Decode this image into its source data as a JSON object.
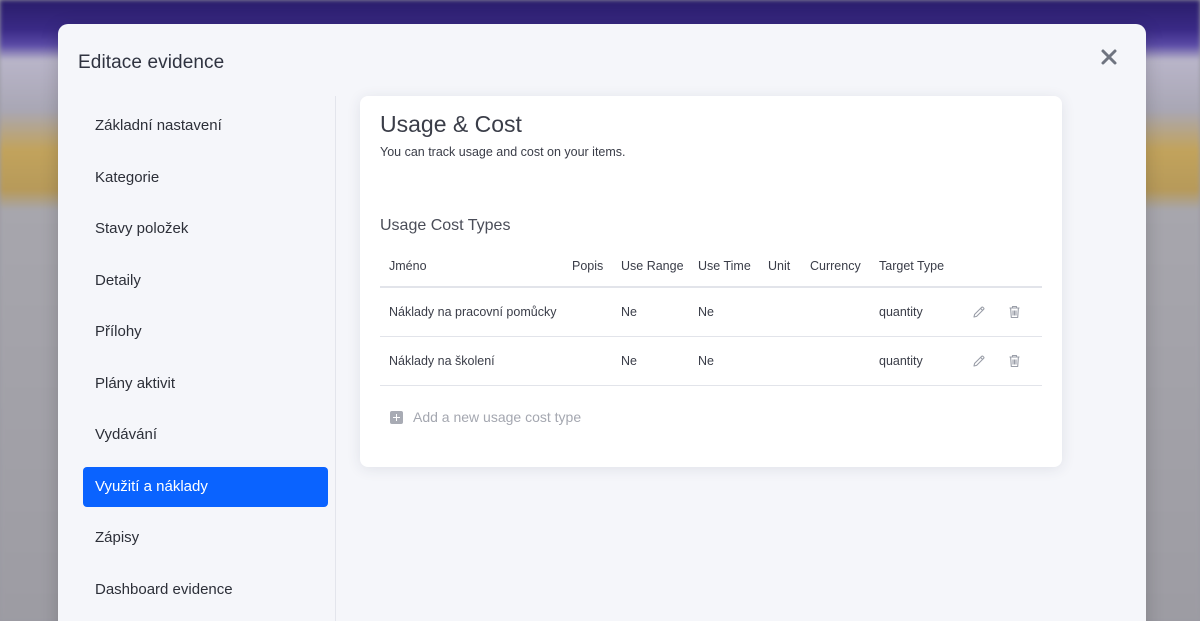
{
  "modal": {
    "title": "Editace evidence"
  },
  "sidebar": {
    "items": [
      {
        "label": "Základní nastavení",
        "active": false
      },
      {
        "label": "Kategorie",
        "active": false
      },
      {
        "label": "Stavy položek",
        "active": false
      },
      {
        "label": "Detaily",
        "active": false
      },
      {
        "label": "Přílohy",
        "active": false
      },
      {
        "label": "Plány aktivit",
        "active": false
      },
      {
        "label": "Vydávání",
        "active": false
      },
      {
        "label": "Využití a náklady",
        "active": true
      },
      {
        "label": "Zápisy",
        "active": false
      },
      {
        "label": "Dashboard evidence",
        "active": false
      }
    ]
  },
  "card": {
    "title": "Usage & Cost",
    "subtitle": "You can track usage and cost on your items.",
    "section_title": "Usage Cost Types",
    "table": {
      "headers": {
        "name": "Jméno",
        "popis": "Popis",
        "use_range": "Use Range",
        "use_time": "Use Time",
        "unit": "Unit",
        "currency": "Currency",
        "target_type": "Target Type"
      },
      "rows": [
        {
          "name": "Náklady na pracovní pomůcky",
          "popis": "",
          "use_range": "Ne",
          "use_time": "Ne",
          "unit": "",
          "currency": "",
          "target_type": "quantity"
        },
        {
          "name": "Náklady na školení",
          "popis": "",
          "use_range": "Ne",
          "use_time": "Ne",
          "unit": "",
          "currency": "",
          "target_type": "quantity"
        }
      ]
    },
    "add_label": "Add a new usage cost type"
  },
  "colors": {
    "accent": "#0a63ff",
    "modal_bg": "#f5f6fa",
    "card_bg": "#ffffff"
  },
  "icons": {
    "close": "close-icon",
    "edit": "pencil-icon",
    "delete": "trash-icon",
    "add": "plus-square-icon"
  }
}
